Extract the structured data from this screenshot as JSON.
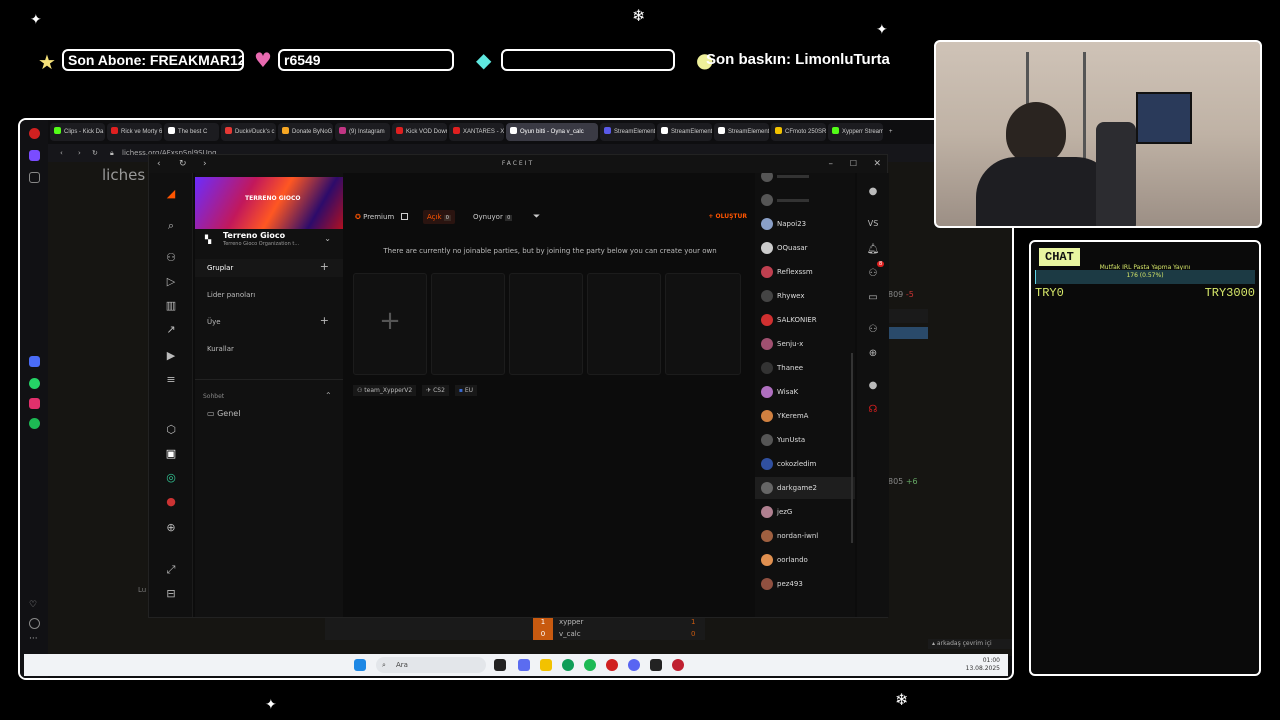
{
  "overlay": {
    "last_sub": "Son Abone: FREAKMAR12",
    "field2": "r6549",
    "field3": "",
    "last_raid": "Son baskın: LimonluTurta"
  },
  "browser": {
    "tabs": [
      {
        "label": "Clips - Kick Da",
        "color": "#53fc18"
      },
      {
        "label": "Rick ve Morty 6",
        "color": "#e02020"
      },
      {
        "label": "The best C",
        "color": "#ffffff"
      },
      {
        "label": "Duck#Duck's c",
        "color": "#e53935"
      },
      {
        "label": "Donate ByNoG",
        "color": "#f6a623"
      },
      {
        "label": "(9) Instagram",
        "color": "#c13584"
      },
      {
        "label": "Kick VOD Down",
        "color": "#e02020"
      },
      {
        "label": "XANTARES - X",
        "color": "#e02020"
      },
      {
        "label": "Oyun bitti - Oyna v_calc",
        "color": "#ffffff"
      },
      {
        "label": "StreamElement",
        "color": "#5a5ae8"
      },
      {
        "label": "StreamElement",
        "color": "#ffffff"
      },
      {
        "label": "StreamElement",
        "color": "#ffffff"
      },
      {
        "label": "CFmoto 250SR",
        "color": "#f2c200"
      },
      {
        "label": "Xypperr Stream",
        "color": "#53fc18"
      }
    ],
    "active_tab": 8,
    "new_tab": "+",
    "url": "lichess.org/AFxspSnl9SUnq",
    "site_name": "liches",
    "bg_number_1": "809",
    "bg_number_1b": "-5",
    "bg_number_2": "805",
    "bg_number_2b": "+6",
    "lu_text": "Lu"
  },
  "faceit": {
    "title": "FACEIT",
    "org_name": "Terreno Gioco",
    "org_sub": "Terreno Gioco Organization t...",
    "banner_logo": "TERRENO GIOCO",
    "sidebar": [
      {
        "label": "Gruplar",
        "plus": "+"
      },
      {
        "label": "Lider panoları",
        "plus": ""
      },
      {
        "label": "Üye",
        "plus": "+"
      },
      {
        "label": "Kurallar",
        "plus": ""
      }
    ],
    "chat_section": "Sohbet",
    "chat_channel": "Genel",
    "filters": {
      "premium": "Premium",
      "open": "Açık",
      "open_count": "0",
      "playing": "Oynuyor",
      "playing_count": "0",
      "create": "+ OLUŞTUR"
    },
    "empty_msg": "There are currently no joinable parties, but by joining the party below you can create your own",
    "party": {
      "name": "team_XypperV2",
      "game": "CS2",
      "region": "EU"
    },
    "friends": [
      {
        "name": "",
        "color": "#555"
      },
      {
        "name": "",
        "color": "#555"
      },
      {
        "name": "Napoi23",
        "color": "#8aa0c8"
      },
      {
        "name": "OQuasar",
        "color": "#cccccc"
      },
      {
        "name": "Reflexssm",
        "color": "#c04050"
      },
      {
        "name": "Rhywex",
        "color": "#444444"
      },
      {
        "name": "SALKONIER",
        "color": "#d03030"
      },
      {
        "name": "Senju-x",
        "color": "#a05070"
      },
      {
        "name": "Thanee",
        "color": "#333333"
      },
      {
        "name": "WisaK",
        "color": "#b070c0"
      },
      {
        "name": "YKeremA",
        "color": "#d08040"
      },
      {
        "name": "YunUsta",
        "color": "#555555"
      },
      {
        "name": "cokozledim",
        "color": "#3050a0"
      },
      {
        "name": "darkgame2",
        "color": "#666666"
      },
      {
        "name": "jezG",
        "color": "#b08090"
      },
      {
        "name": "nordan-iwnl",
        "color": "#a06040"
      },
      {
        "name": "oorlando",
        "color": "#e09050"
      },
      {
        "name": "pez493",
        "color": "#905040"
      }
    ],
    "right_vs": "VS",
    "notif_count": "8"
  },
  "game_bar": {
    "rows": [
      {
        "num": "1",
        "name": "xypper",
        "score": "1"
      },
      {
        "num": "0",
        "name": "v_calc",
        "score": "0"
      }
    ]
  },
  "status_hint": "arkadaş çevrim içi",
  "taskbar": {
    "search": "Ara",
    "time": "01:00",
    "date": "13.08.2025"
  },
  "chat": {
    "title": "CHAT",
    "subtitle": "Mutfak IRL Pasta Yapma Yayını",
    "goal_text": "176 (0.57%)",
    "goal_fraction": 0.0057,
    "min": "TRY0",
    "max": "TRY3000"
  }
}
